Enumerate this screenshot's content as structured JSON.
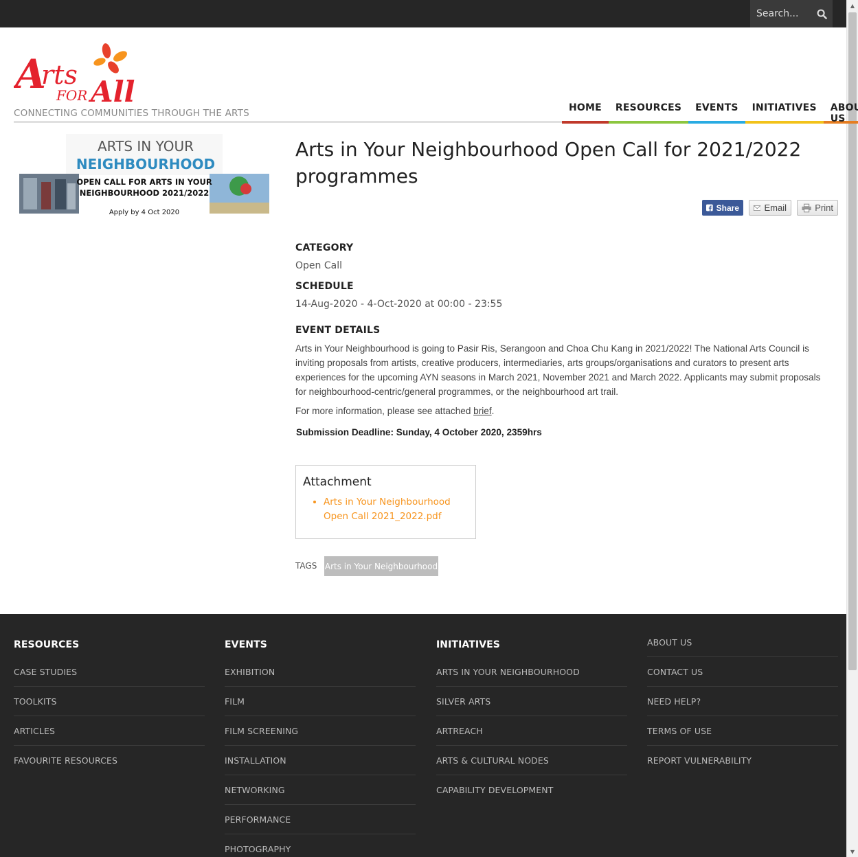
{
  "search": {
    "placeholder": "Search..."
  },
  "header": {
    "tagline": "CONNECTING COMMUNITIES THROUGH THE ARTS",
    "logo_text": "Arts for All"
  },
  "nav": [
    {
      "label": "HOME",
      "color": "#c0392b"
    },
    {
      "label": "RESOURCES",
      "color": "#8cc63f"
    },
    {
      "label": "EVENTS",
      "color": "#29abe2"
    },
    {
      "label": "INITIATIVES",
      "color": "#f2c21a"
    },
    {
      "label": "ABOUT US",
      "color": "#e67e22"
    }
  ],
  "promo": {
    "line1": "ARTS IN YOUR",
    "line2": "NEIGHBOURHOOD",
    "line3": "OPEN CALL FOR ARTS IN YOUR",
    "line4": "NEIGHBOURHOOD 2021/2022",
    "line5": "Apply by 4 Oct 2020"
  },
  "event": {
    "title": "Arts in Your Neighbourhood Open Call for 2021/2022 programmes",
    "share_label": "Share",
    "email_label": "Email",
    "print_label": "Print",
    "category_label": "CATEGORY",
    "category": "Open Call",
    "schedule_label": "SCHEDULE",
    "schedule": "14-Aug-2020 - 4-Oct-2020 at 00:00 - 23:55",
    "details_label": "EVENT DETAILS",
    "details": "Arts in Your Neighbourhood is going to Pasir Ris, Serangoon and Choa Chu Kang in 2021/2022! The National Arts Council is inviting proposals from artists, creative producers, intermediaries, arts groups/organisations and curators to present arts experiences for the upcoming AYN seasons in March 2021, November 2021 and March 2022. Applicants may submit proposals for neighbourhood-centric/general programmes, or the neighbourhood art trail.",
    "more_prefix": "For more information, please see attached ",
    "more_link": "brief",
    "more_suffix": ".",
    "deadline": "Submission Deadline: Sunday, 4 October 2020, 2359hrs"
  },
  "attachment": {
    "title": "Attachment",
    "file": "Arts in Your Neighbourhood Open Call 2021_2022.pdf"
  },
  "tags": {
    "label": "TAGS",
    "items": [
      "Arts in Your Neighbourhood"
    ]
  },
  "footer": {
    "resources": {
      "heading": "RESOURCES",
      "links": [
        "CASE STUDIES",
        "TOOLKITS",
        "ARTICLES",
        "FAVOURITE RESOURCES"
      ]
    },
    "events": {
      "heading": "EVENTS",
      "links": [
        "EXHIBITION",
        "FILM",
        "FILM SCREENING",
        "INSTALLATION",
        "NETWORKING",
        "PERFORMANCE",
        "PHOTOGRAPHY"
      ]
    },
    "initiatives": {
      "heading": "INITIATIVES",
      "links": [
        "ARTS IN YOUR NEIGHBOURHOOD",
        "SILVER ARTS",
        "ARTREACH",
        "ARTS & CULTURAL NODES",
        "CAPABILITY DEVELOPMENT"
      ]
    },
    "about": {
      "links": [
        "ABOUT US",
        "CONTACT US",
        "NEED HELP?",
        "TERMS OF USE",
        "REPORT VULNERABILITY"
      ]
    }
  }
}
